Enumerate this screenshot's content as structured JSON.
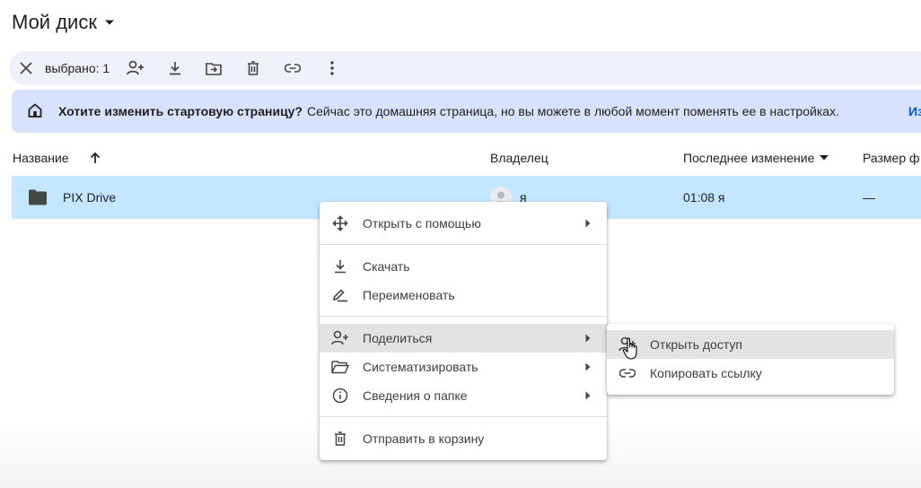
{
  "header": {
    "title": "Мой диск"
  },
  "toolbar": {
    "selected_count": "выбрано: 1"
  },
  "banner": {
    "question": "Хотите изменить стартовую страницу?",
    "description": "Сейчас это домашняя страница, но вы можете в любой момент поменять ее в настройках.",
    "link": "Из"
  },
  "columns": {
    "name": "Название",
    "owner": "Владелец",
    "modified": "Последнее изменение",
    "size": "Размер ф"
  },
  "files": [
    {
      "name": "PIX Drive",
      "owner": "я",
      "modified": "01:08 я",
      "size": "—"
    }
  ],
  "context_menu": {
    "open_with": "Открыть с помощью",
    "download": "Скачать",
    "rename": "Переименовать",
    "share": "Поделиться",
    "organize": "Систематизировать",
    "folder_info": "Сведения о папке",
    "trash": "Отправить в корзину"
  },
  "share_submenu": {
    "open_access": "Открыть доступ",
    "copy_link": "Копировать ссылку"
  },
  "colors": {
    "selected_row": "#c2e7ff",
    "banner": "#d7e3fc",
    "toolbar": "#eef1f8",
    "menu_highlight": "#e3e3e3",
    "link": "#0b57d0"
  }
}
